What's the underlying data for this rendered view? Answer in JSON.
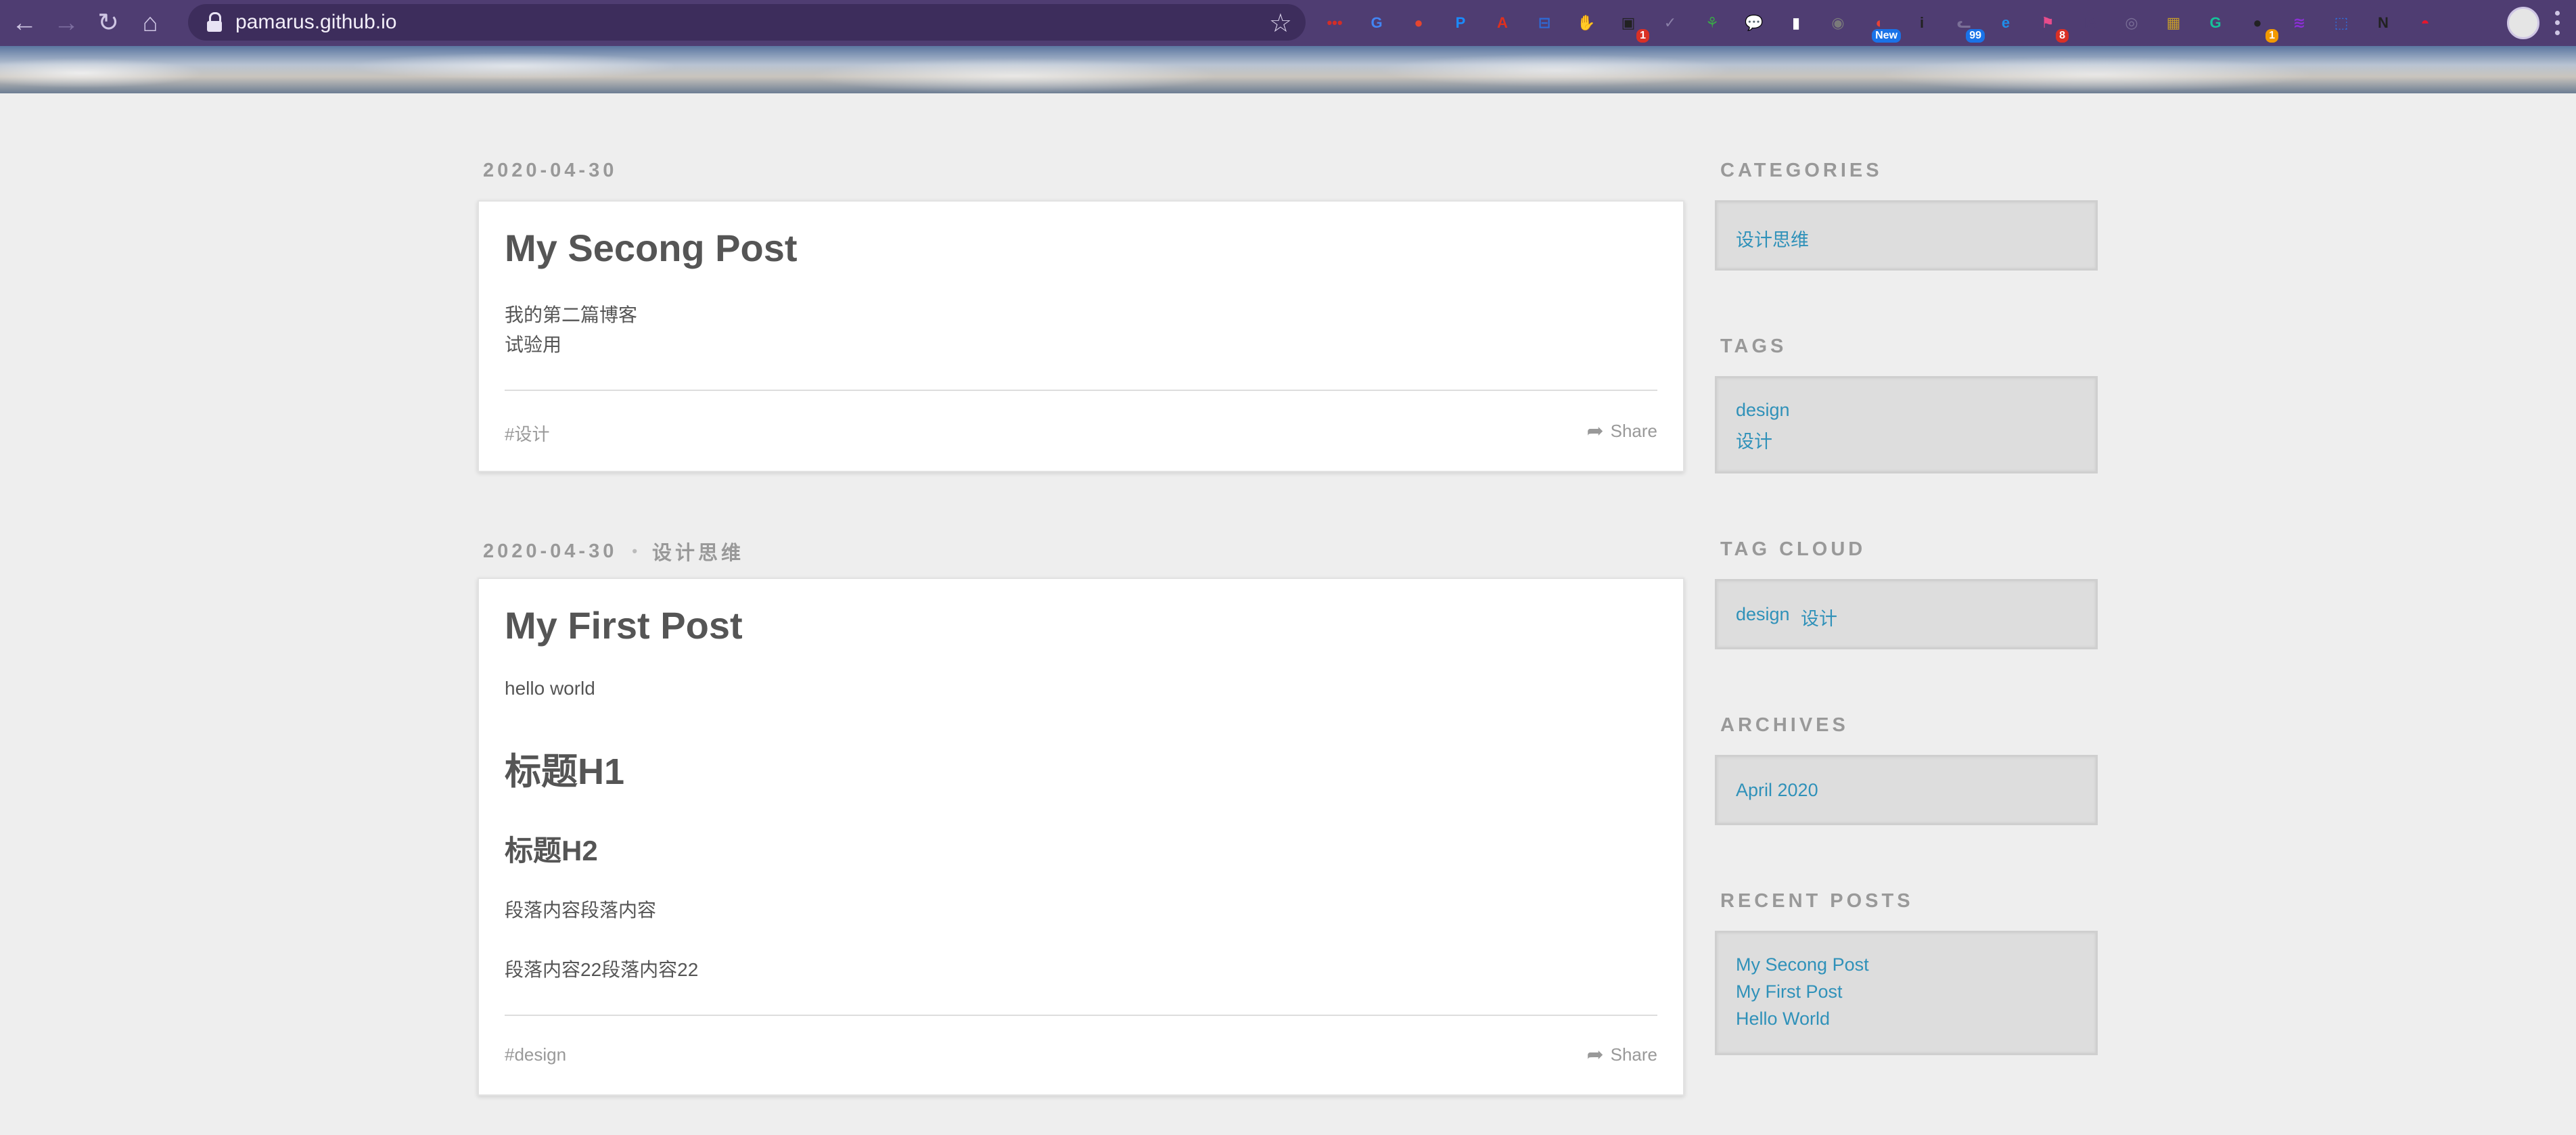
{
  "browser": {
    "url": "pamarus.github.io",
    "extensions": [
      {
        "name": "lastpass-icon",
        "label": "•••",
        "color": "#d32d27"
      },
      {
        "name": "google-translate-icon",
        "label": "G",
        "color": "#4285f4"
      },
      {
        "name": "maps-pin-icon",
        "label": "●",
        "color": "#e5452f"
      },
      {
        "name": "1password-icon",
        "label": "P",
        "color": "#1a8cff"
      },
      {
        "name": "acrobat-icon",
        "label": "A",
        "color": "#e0301e"
      },
      {
        "name": "wallet-icon",
        "label": "⊟",
        "color": "#2d6bd8"
      },
      {
        "name": "adblock-hand-icon",
        "label": "✋",
        "color": "#d93025"
      },
      {
        "name": "screen-reader-icon",
        "label": "▣",
        "color": "#222222",
        "badge": "1",
        "badge_color": "red"
      },
      {
        "name": "checkmark-icon",
        "label": "✓",
        "color": "#8a7fa8"
      },
      {
        "name": "plant-icon",
        "label": "⚘",
        "color": "#3aa648"
      },
      {
        "name": "chat-bubble-icon",
        "label": "💬",
        "color": "#2a2a2a"
      },
      {
        "name": "bookmark-icon",
        "label": "▮",
        "color": "#ffffff"
      },
      {
        "name": "camera-icon",
        "label": "◉",
        "color": "#7a7a7a"
      },
      {
        "name": "chrome-new-icon",
        "label": "◐",
        "color": "#e94235",
        "badge": "New",
        "badge_color": "blue"
      },
      {
        "name": "info-icon",
        "label": "i",
        "color": "#222222"
      },
      {
        "name": "cat-icon",
        "label": "ᓚ",
        "color": "#7a6f97",
        "badge": "99",
        "badge_color": "blue"
      },
      {
        "name": "edge-icon",
        "label": "e",
        "color": "#1f8ee9"
      },
      {
        "name": "flag-icon",
        "label": "⚑",
        "color": "#e74c8b",
        "badge": "8",
        "badge_color": "red"
      },
      {
        "name": "ia-icon",
        "label": "IA",
        "color": "#4f3d72"
      },
      {
        "name": "clip-icon",
        "label": "◎",
        "color": "#7a6f97"
      },
      {
        "name": "gallery-icon",
        "label": "▦",
        "color": "#c49b2a"
      },
      {
        "name": "grammarly-icon",
        "label": "G",
        "color": "#15c39a"
      },
      {
        "name": "dark-circle-icon",
        "label": "●",
        "color": "#222222",
        "badge": "1",
        "badge_color": "orange"
      },
      {
        "name": "purple-app-icon",
        "label": "≋",
        "color": "#8b2fd6"
      },
      {
        "name": "crop-icon",
        "label": "⬚",
        "color": "#2f6fe0"
      },
      {
        "name": "notion-icon",
        "label": "N",
        "color": "#222222"
      },
      {
        "name": "weibo-icon",
        "label": "◓",
        "color": "#e6162d"
      }
    ]
  },
  "posts": [
    {
      "date": "2020-04-30",
      "category": "",
      "title": "My Secong Post",
      "lines": [
        "我的第二篇博客",
        "试验用"
      ],
      "tag": "#设计",
      "share_label": "Share"
    },
    {
      "date": "2020-04-30",
      "separator": "•",
      "category": "设计思维",
      "title": "My First Post",
      "intro": "hello world",
      "h1": "标题H1",
      "h2": "标题H2",
      "para1": "段落内容段落内容",
      "para2": "段落内容22段落内容22",
      "tag": "#design",
      "share_label": "Share"
    }
  ],
  "sidebar": {
    "categories": {
      "heading": "CATEGORIES",
      "items": [
        "设计思维"
      ]
    },
    "tags": {
      "heading": "TAGS",
      "items": [
        "design",
        "设计"
      ]
    },
    "tag_cloud": {
      "heading": "TAG CLOUD",
      "items": [
        "design",
        "设计"
      ]
    },
    "archives": {
      "heading": "ARCHIVES",
      "items": [
        "April 2020"
      ]
    },
    "recent_posts": {
      "heading": "RECENT POSTS",
      "items": [
        "My Secong Post",
        "My First Post",
        "Hello World"
      ]
    }
  }
}
